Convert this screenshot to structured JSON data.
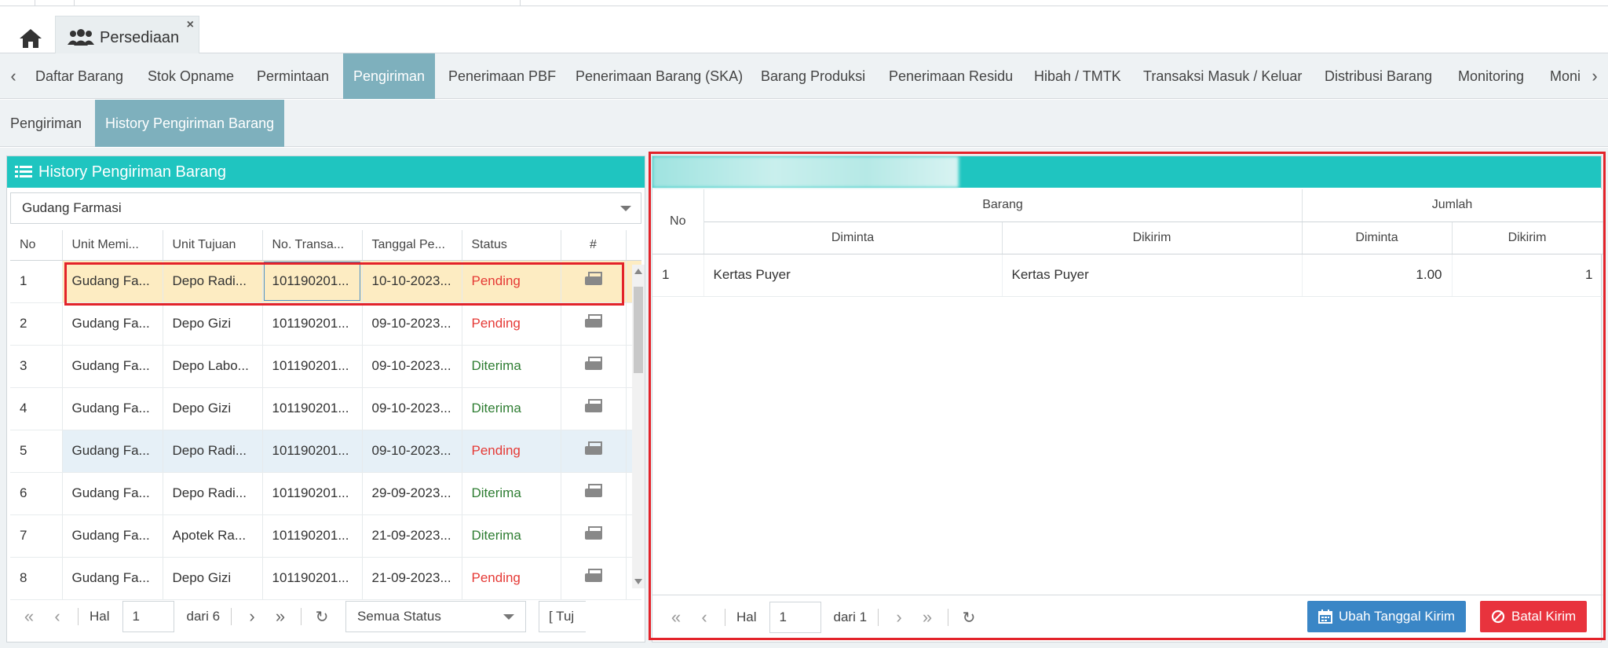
{
  "app_tabs": {
    "module_tab_label": "Persediaan",
    "close_glyph": "×"
  },
  "menu": {
    "items": [
      "Daftar Barang",
      "Stok Opname",
      "Permintaan",
      "Pengiriman",
      "Penerimaan PBF",
      "Penerimaan Barang (SKA)",
      "Barang Produksi",
      "Penerimaan Residu",
      "Hibah / TMTK",
      "Transaksi Masuk / Keluar",
      "Distribusi Barang",
      "Monitoring",
      "Moni"
    ],
    "active": "Pengiriman"
  },
  "submenu": {
    "items": [
      "Pengiriman",
      "History Pengiriman Barang"
    ],
    "active": "History Pengiriman Barang"
  },
  "left_panel": {
    "title": "History Pengiriman Barang",
    "warehouse_select": "Gudang Farmasi",
    "columns": [
      "No",
      "Unit Memi...",
      "Unit Tujuan",
      "No. Transa...",
      "Tanggal Pe...",
      "Status",
      "#"
    ],
    "rows": [
      {
        "no": "1",
        "unit": "Gudang Fa...",
        "tujuan": "Depo Radi...",
        "trx": "101190201...",
        "tgl": "10-10-2023...",
        "status": "Pending"
      },
      {
        "no": "2",
        "unit": "Gudang Fa...",
        "tujuan": "Depo Gizi",
        "trx": "101190201...",
        "tgl": "09-10-2023...",
        "status": "Pending"
      },
      {
        "no": "3",
        "unit": "Gudang Fa...",
        "tujuan": "Depo Labo...",
        "trx": "101190201...",
        "tgl": "09-10-2023...",
        "status": "Diterima"
      },
      {
        "no": "4",
        "unit": "Gudang Fa...",
        "tujuan": "Depo Gizi",
        "trx": "101190201...",
        "tgl": "09-10-2023...",
        "status": "Diterima"
      },
      {
        "no": "5",
        "unit": "Gudang Fa...",
        "tujuan": "Depo Radi...",
        "trx": "101190201...",
        "tgl": "09-10-2023...",
        "status": "Pending"
      },
      {
        "no": "6",
        "unit": "Gudang Fa...",
        "tujuan": "Depo Radi...",
        "trx": "101190201...",
        "tgl": "29-09-2023...",
        "status": "Diterima"
      },
      {
        "no": "7",
        "unit": "Gudang Fa...",
        "tujuan": "Apotek Ra...",
        "trx": "101190201...",
        "tgl": "21-09-2023...",
        "status": "Diterima"
      },
      {
        "no": "8",
        "unit": "Gudang Fa...",
        "tujuan": "Depo Gizi",
        "trx": "101190201...",
        "tgl": "21-09-2023...",
        "status": "Pending"
      }
    ],
    "pager": {
      "hal_label": "Hal",
      "page": "1",
      "of_label": "dari 6",
      "status_filter": "Semua Status",
      "extra_filter": "[ Tuj"
    }
  },
  "right_panel": {
    "group_headers": {
      "no": "No",
      "barang": "Barang",
      "jumlah": "Jumlah"
    },
    "sub_headers": {
      "diminta": "Diminta",
      "dikirim": "Dikirim",
      "jml_diminta": "Diminta",
      "jml_dikirim": "Dikirim"
    },
    "rows": [
      {
        "no": "1",
        "diminta": "Kertas Puyer",
        "dikirim": "Kertas Puyer",
        "jml_diminta": "1.00",
        "jml_dikirim": "1"
      }
    ],
    "pager": {
      "hal_label": "Hal",
      "page": "1",
      "of_label": "dari 1"
    },
    "buttons": {
      "change_date": "Ubah Tanggal Kirim",
      "cancel_send": "Batal Kirim"
    }
  },
  "colors": {
    "header_teal": "#1fc5c0",
    "menu_active": "#7eb0bd",
    "pending": "#e53935",
    "received": "#2e7d32",
    "highlight": "#e3232a"
  }
}
